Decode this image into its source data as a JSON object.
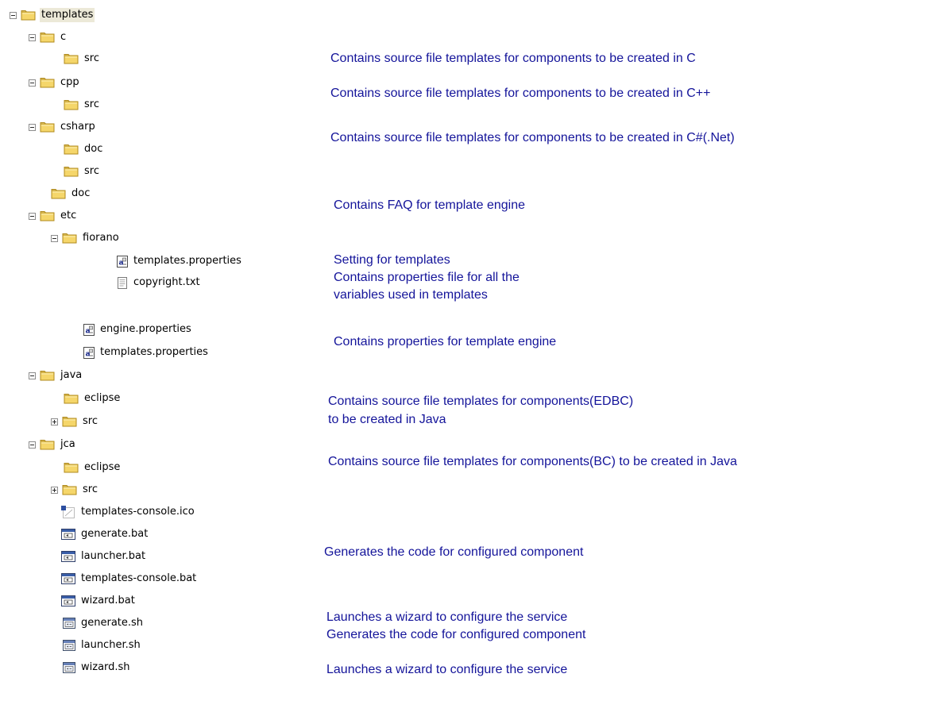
{
  "tree": {
    "root": "templates",
    "c": "c",
    "c_src": "src",
    "cpp": "cpp",
    "cpp_src": "src",
    "csharp": "csharp",
    "csharp_doc": "doc",
    "csharp_src": "src",
    "doc": "doc",
    "etc": "etc",
    "fiorano": "fiorano",
    "fiorano_templates_properties": "templates.properties",
    "fiorano_copyright": "copyright.txt",
    "engine_properties": "engine.properties",
    "etc_templates_properties": "templates.properties",
    "java": "java",
    "java_eclipse": "eclipse",
    "java_src": "src",
    "jca": "jca",
    "jca_eclipse": "eclipse",
    "jca_src": "src",
    "templates_console_ico": "templates-console.ico",
    "generate_bat": "generate.bat",
    "launcher_bat": "launcher.bat",
    "templates_console_bat": "templates-console.bat",
    "wizard_bat": "wizard.bat",
    "generate_sh": "generate.sh",
    "launcher_sh": "launcher.sh",
    "wizard_sh": "wizard.sh"
  },
  "descriptions": {
    "c": "Contains source file templates for components to be created in C",
    "cpp": "Contains source file templates for components to be created in C++",
    "csharp": "Contains source file templates for components to be created in C#(.Net)",
    "doc": "Contains FAQ for template engine",
    "fiorano": "Setting for templates",
    "properties_1": "Contains properties file for all the",
    "properties_2": "variables used in templates",
    "engine": "Contains properties for template engine",
    "java_1": "Contains source file templates for components(EDBC)",
    "java_2": "to be created in Java",
    "jca": "Contains source file templates for components(BC) to be created in Java",
    "generate_bat": "Generates the code for configured component",
    "wizard_bat": "Launches a wizard to configure the service",
    "generate_sh": "Generates the code for configured component",
    "wizard_sh": "Launches a wizard to configure the service"
  },
  "colors": {
    "description_text": "#14149a",
    "folder_fill": "#f5d66a",
    "folder_outline": "#b08a1c",
    "selection_bg": "#ece9d8"
  }
}
